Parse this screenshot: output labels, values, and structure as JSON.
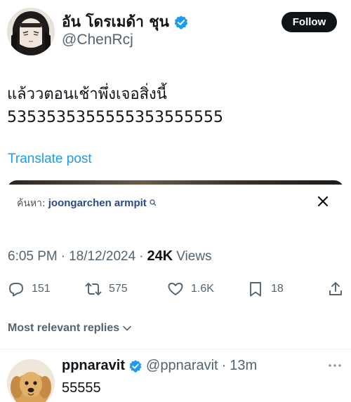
{
  "author": {
    "display_name": "อัน โดรเมด้า ชุน",
    "handle": "@ChenRcj",
    "verified": true,
    "avatar": "anime-character-avatar"
  },
  "follow_button": {
    "label": "Follow"
  },
  "post": {
    "text": "แล้ววตอนเช้าพึ่งเจอสิ่งนี้\n5353535355555353555555",
    "translate_label": "Translate post"
  },
  "media_card": {
    "search_prefix": "ค้นหา:",
    "search_term": "joongarchen armpit",
    "close_icon": "close-icon"
  },
  "meta": {
    "time": "6:05 PM",
    "sep1": "·",
    "date": "18/12/2024",
    "sep2": "·",
    "views_count": "24K",
    "views_label": "Views"
  },
  "actions": {
    "replies": "151",
    "reposts": "575",
    "likes": "1.6K",
    "bookmarks": "18"
  },
  "replies_sort": {
    "label": "Most relevant replies"
  },
  "reply": {
    "display_name": "ppnaravit",
    "handle": "@ppnaravit",
    "sep": "·",
    "time": "13m",
    "text": "55555",
    "verified": true,
    "avatar": "golden-retriever-avatar"
  },
  "colors": {
    "accent": "#1d9bf0",
    "text": "#0f1419",
    "muted": "#536471",
    "follow_bg": "#0f1419"
  }
}
